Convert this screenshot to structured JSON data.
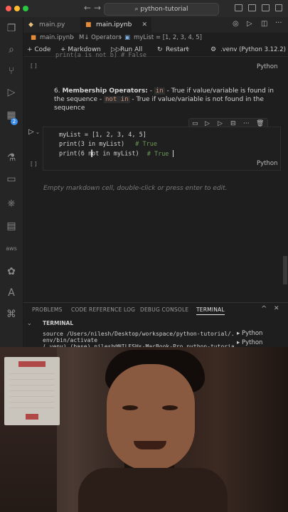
{
  "window": {
    "search_label": "python-tutorial"
  },
  "tabs": [
    {
      "label": "main.py",
      "icon": "python-file-icon"
    },
    {
      "label": "main.ipynb",
      "icon": "notebook-icon"
    }
  ],
  "breadcrumb": {
    "file": "main.ipynb",
    "section": "M↓ Operators",
    "symbol": "myList = [1, 2, 3, 4, 5]"
  },
  "notebook_toolbar": {
    "code": "+ Code",
    "markdown": "+ Markdown",
    "run_all": "Run All",
    "restart": "Restart",
    "more": "···",
    "kernel": ".venv (Python 3.12.2)"
  },
  "activity_badge": "2",
  "cells": {
    "prev_code_partial": "print(a is not b) # False",
    "prev_lang": "Python",
    "markdown": {
      "number": "6.",
      "title": "Membership Operators:",
      "line1_sep": " - ",
      "in_kw": "in",
      "line1_rest": " - True if value/variable is found in the sequence - ",
      "notin_kw": "not in",
      "line2_rest": " - True if value/variable is not found in the sequence"
    },
    "code": {
      "lines": [
        {
          "text": "myList = [1, 2, 3, 4, 5]"
        },
        {
          "pre": "print(3 in myList)",
          "comment": "# True"
        },
        {
          "pre": "print(6 not in myList)",
          "comment": "# True"
        }
      ],
      "lang": "Python"
    },
    "empty_markdown": "Empty markdown cell, double-click or press enter to edit."
  },
  "panel": {
    "tabs": [
      "PROBLEMS",
      "CODE REFERENCE LOG",
      "DEBUG CONSOLE",
      "TERMINAL"
    ],
    "active": "TERMINAL",
    "section": "TERMINAL",
    "lines": [
      "source /Users/nilesh/Desktop/workspace/python-tutorial/.v",
      "env/bin/activate",
      "(.venv) (base) nilesh@NILESHs-MacBook-Pro python-tutorial"
    ],
    "sessions": [
      "Python",
      "Python"
    ]
  },
  "colors": {
    "keyword": "#569cd6",
    "comment": "#6a9955",
    "accent": "#3b8eea"
  }
}
